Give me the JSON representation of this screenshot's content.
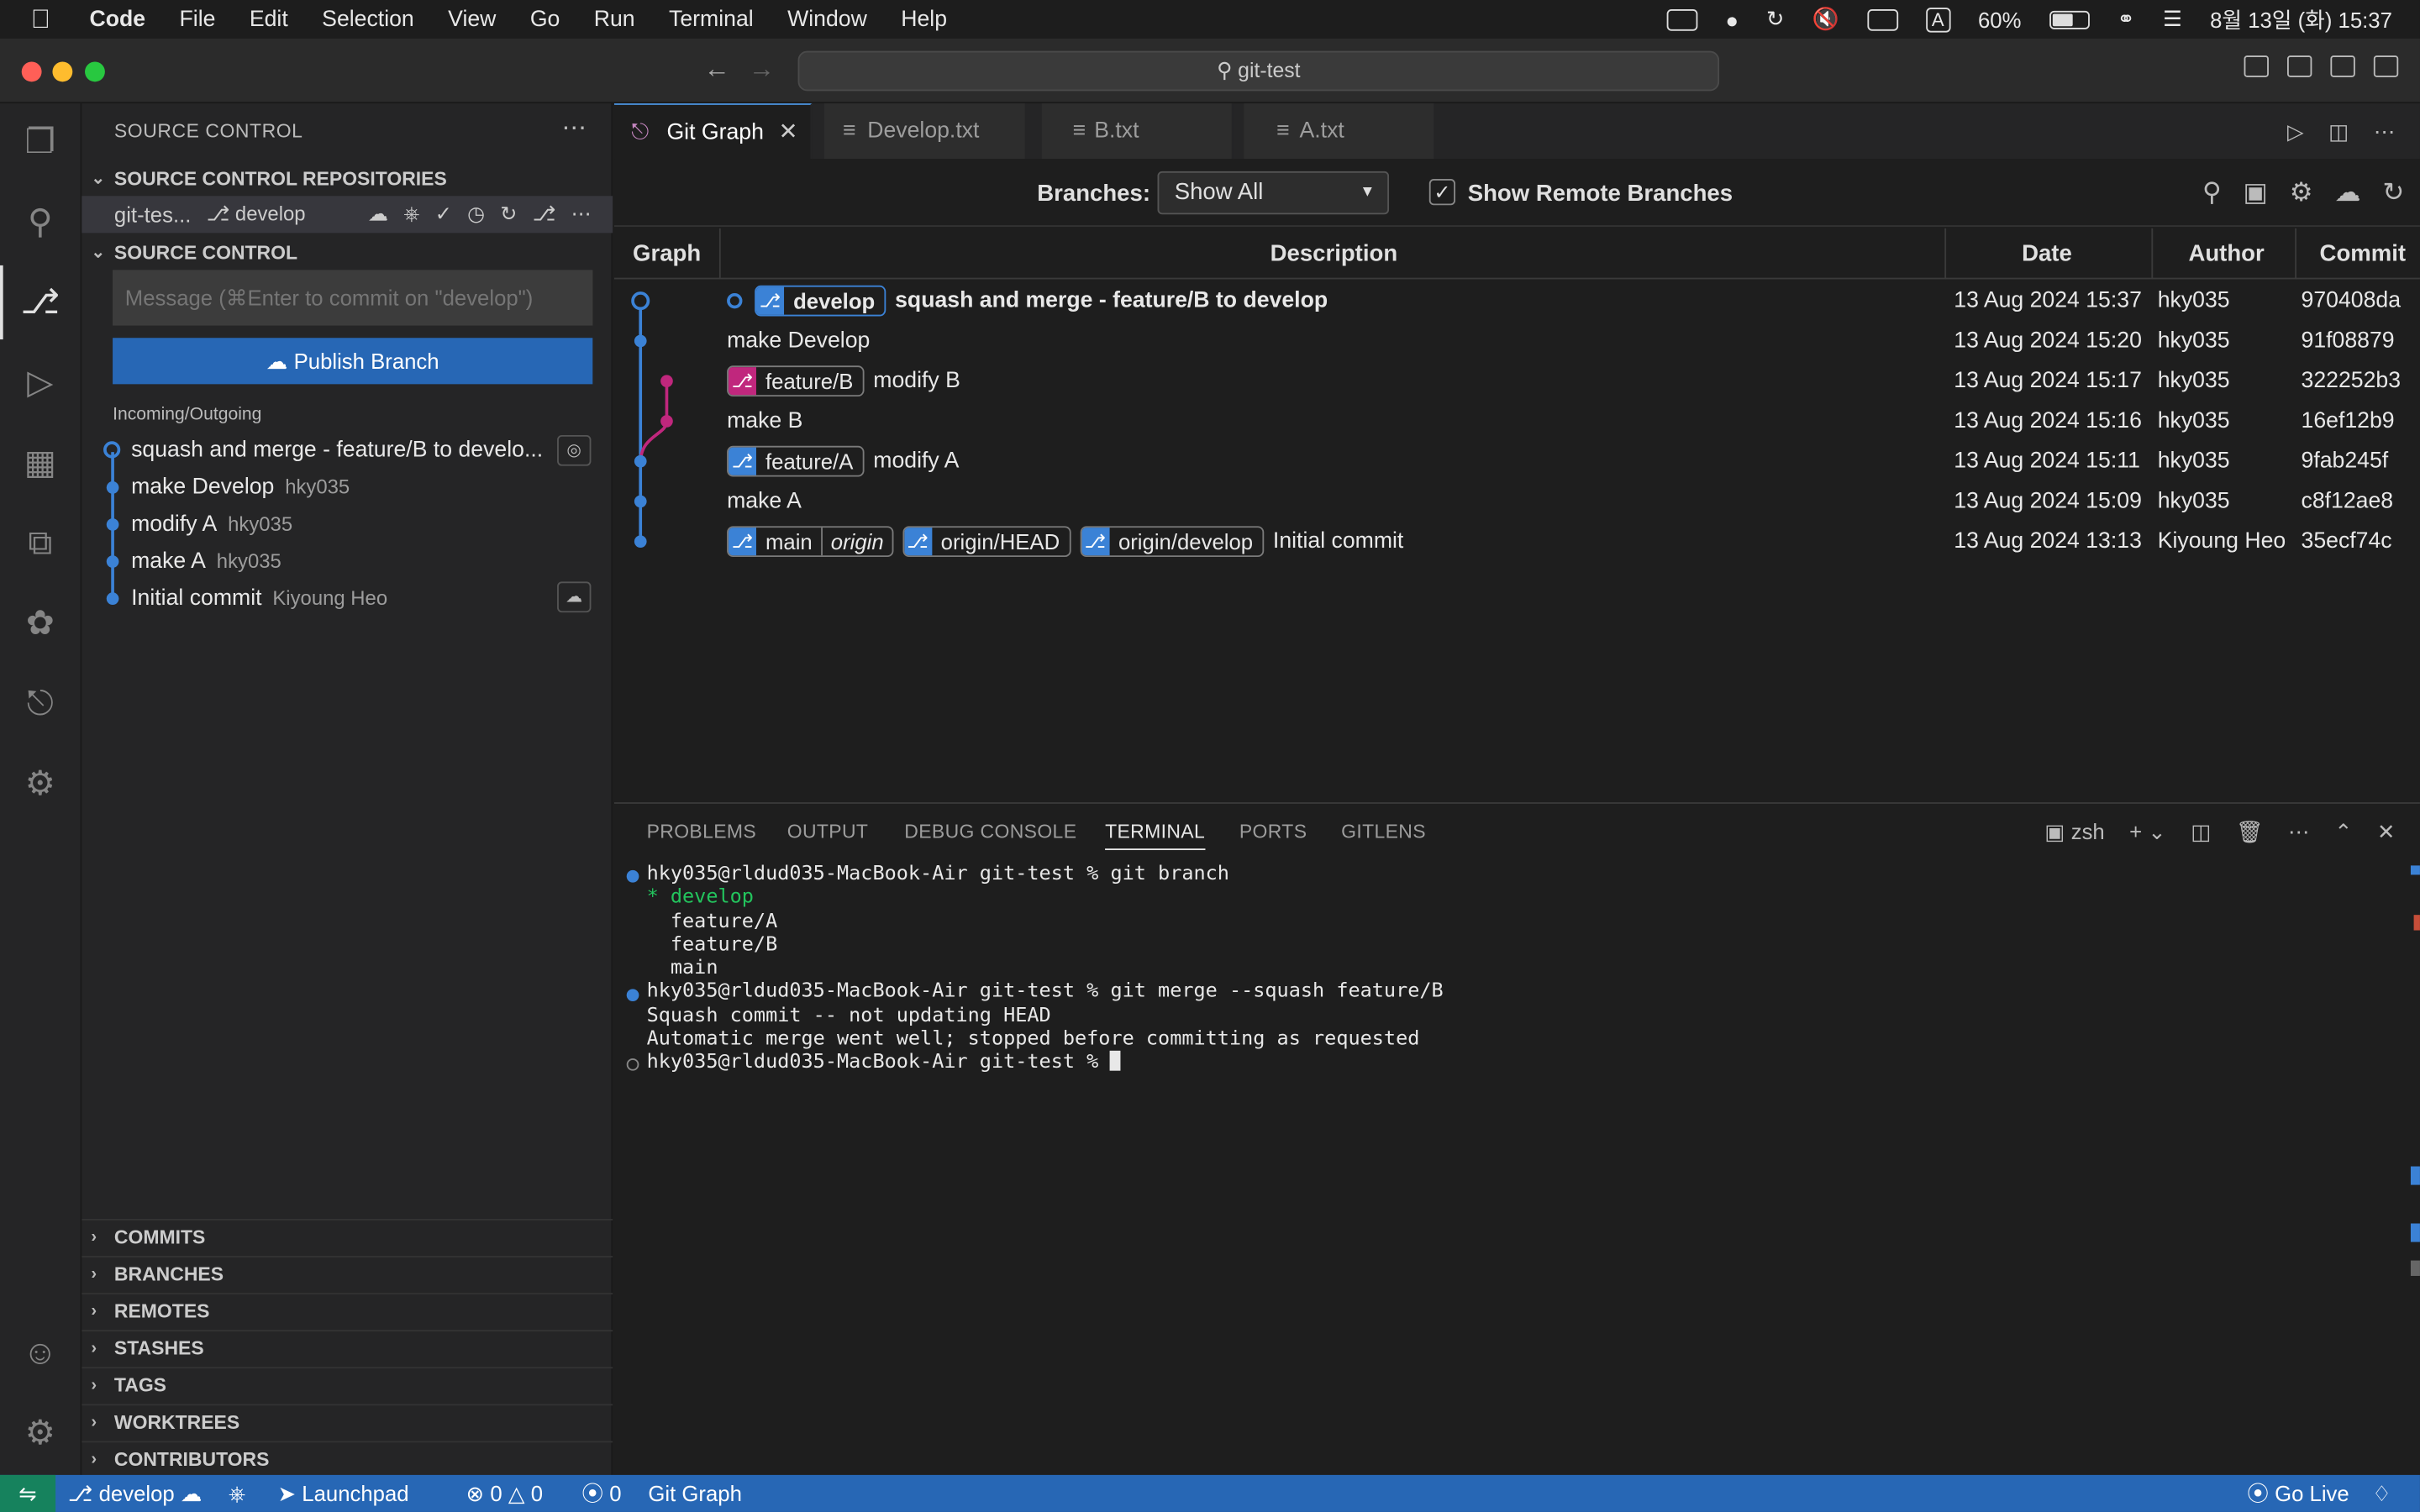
{
  "menubar": {
    "app": "Code",
    "items": [
      "File",
      "Edit",
      "Selection",
      "View",
      "Go",
      "Run",
      "Terminal",
      "Window",
      "Help"
    ],
    "battery": "60%",
    "input_mode": "A",
    "datetime": "8월 13일 (화) 15:37"
  },
  "window": {
    "title": "git-test"
  },
  "sidebar": {
    "title": "SOURCE CONTROL",
    "repos_header": "SOURCE CONTROL REPOSITORIES",
    "repo_name": "git-tes...",
    "repo_branch": "develop",
    "sc_header": "SOURCE CONTROL",
    "message_placeholder": "Message (⌘Enter to commit on \"develop\")",
    "publish_label": "Publish Branch",
    "incoming_outgoing": "Incoming/Outgoing",
    "history": [
      {
        "msg": "squash and merge - feature/B to develo...",
        "author": ""
      },
      {
        "msg": "make Develop",
        "author": "hky035"
      },
      {
        "msg": "modify A",
        "author": "hky035"
      },
      {
        "msg": "make A",
        "author": "hky035"
      },
      {
        "msg": "Initial commit",
        "author": "Kiyoung Heo"
      }
    ],
    "bottom_sections": [
      "COMMITS",
      "BRANCHES",
      "REMOTES",
      "STASHES",
      "TAGS",
      "WORKTREES",
      "CONTRIBUTORS"
    ]
  },
  "tabs": [
    {
      "label": "Git Graph",
      "active": true
    },
    {
      "label": "Develop.txt"
    },
    {
      "label": "B.txt"
    },
    {
      "label": "A.txt"
    }
  ],
  "gitgraph": {
    "branches_label": "Branches:",
    "branches_value": "Show All",
    "show_remote_label": "Show Remote Branches",
    "show_remote_checked": true,
    "columns": [
      "Graph",
      "Description",
      "Date",
      "Author",
      "Commit"
    ],
    "rows": [
      {
        "refs": [
          {
            "name": "develop",
            "head": true,
            "color": "#3b82d6"
          }
        ],
        "desc": "squash and merge - feature/B to develop",
        "date": "13 Aug 2024 15:37",
        "author": "hky035",
        "commit": "970408da"
      },
      {
        "refs": [],
        "desc": "make Develop",
        "date": "13 Aug 2024 15:20",
        "author": "hky035",
        "commit": "91f08879"
      },
      {
        "refs": [
          {
            "name": "feature/B",
            "color": "#c0277d"
          }
        ],
        "desc": "modify B",
        "date": "13 Aug 2024 15:17",
        "author": "hky035",
        "commit": "322252b3"
      },
      {
        "refs": [],
        "desc": "make B",
        "date": "13 Aug 2024 15:16",
        "author": "hky035",
        "commit": "16ef12b9"
      },
      {
        "refs": [
          {
            "name": "feature/A",
            "color": "#3b82d6"
          }
        ],
        "desc": "modify A",
        "date": "13 Aug 2024 15:11",
        "author": "hky035",
        "commit": "9fab245f"
      },
      {
        "refs": [],
        "desc": "make A",
        "date": "13 Aug 2024 15:09",
        "author": "hky035",
        "commit": "c8f12ae8"
      },
      {
        "refs": [
          {
            "name": "main",
            "remote": "origin",
            "color": "#3b82d6"
          },
          {
            "name": "origin/HEAD",
            "color": "#3b82d6"
          },
          {
            "name": "origin/develop",
            "color": "#3b82d6"
          }
        ],
        "desc": "Initial commit",
        "date": "13 Aug 2024 13:13",
        "author": "Kiyoung Heo",
        "commit": "35ecf74c"
      }
    ]
  },
  "panel": {
    "tabs": [
      "PROBLEMS",
      "OUTPUT",
      "DEBUG CONSOLE",
      "TERMINAL",
      "PORTS",
      "GITLENS"
    ],
    "active_tab": "TERMINAL",
    "shell": "zsh",
    "terminal_lines": [
      "hky035@rldud035-MacBook-Air git-test % git branch",
      "* develop",
      "  feature/A",
      "  feature/B",
      "  main",
      "hky035@rldud035-MacBook-Air git-test % git merge --squash feature/B",
      "Squash commit -- not updating HEAD",
      "Automatic merge went well; stopped before committing as requested",
      "hky035@rldud035-MacBook-Air git-test % "
    ]
  },
  "statusbar": {
    "branch": "develop",
    "launchpad": "Launchpad",
    "errors": "0",
    "warnings": "0",
    "ports": "0",
    "gitgraph": "Git Graph",
    "golive": "Go Live"
  },
  "colors": {
    "accent": "#2767b5",
    "branch_blue": "#3b82d6",
    "branch_pink": "#c0277d",
    "remote_green": "#16825d"
  }
}
